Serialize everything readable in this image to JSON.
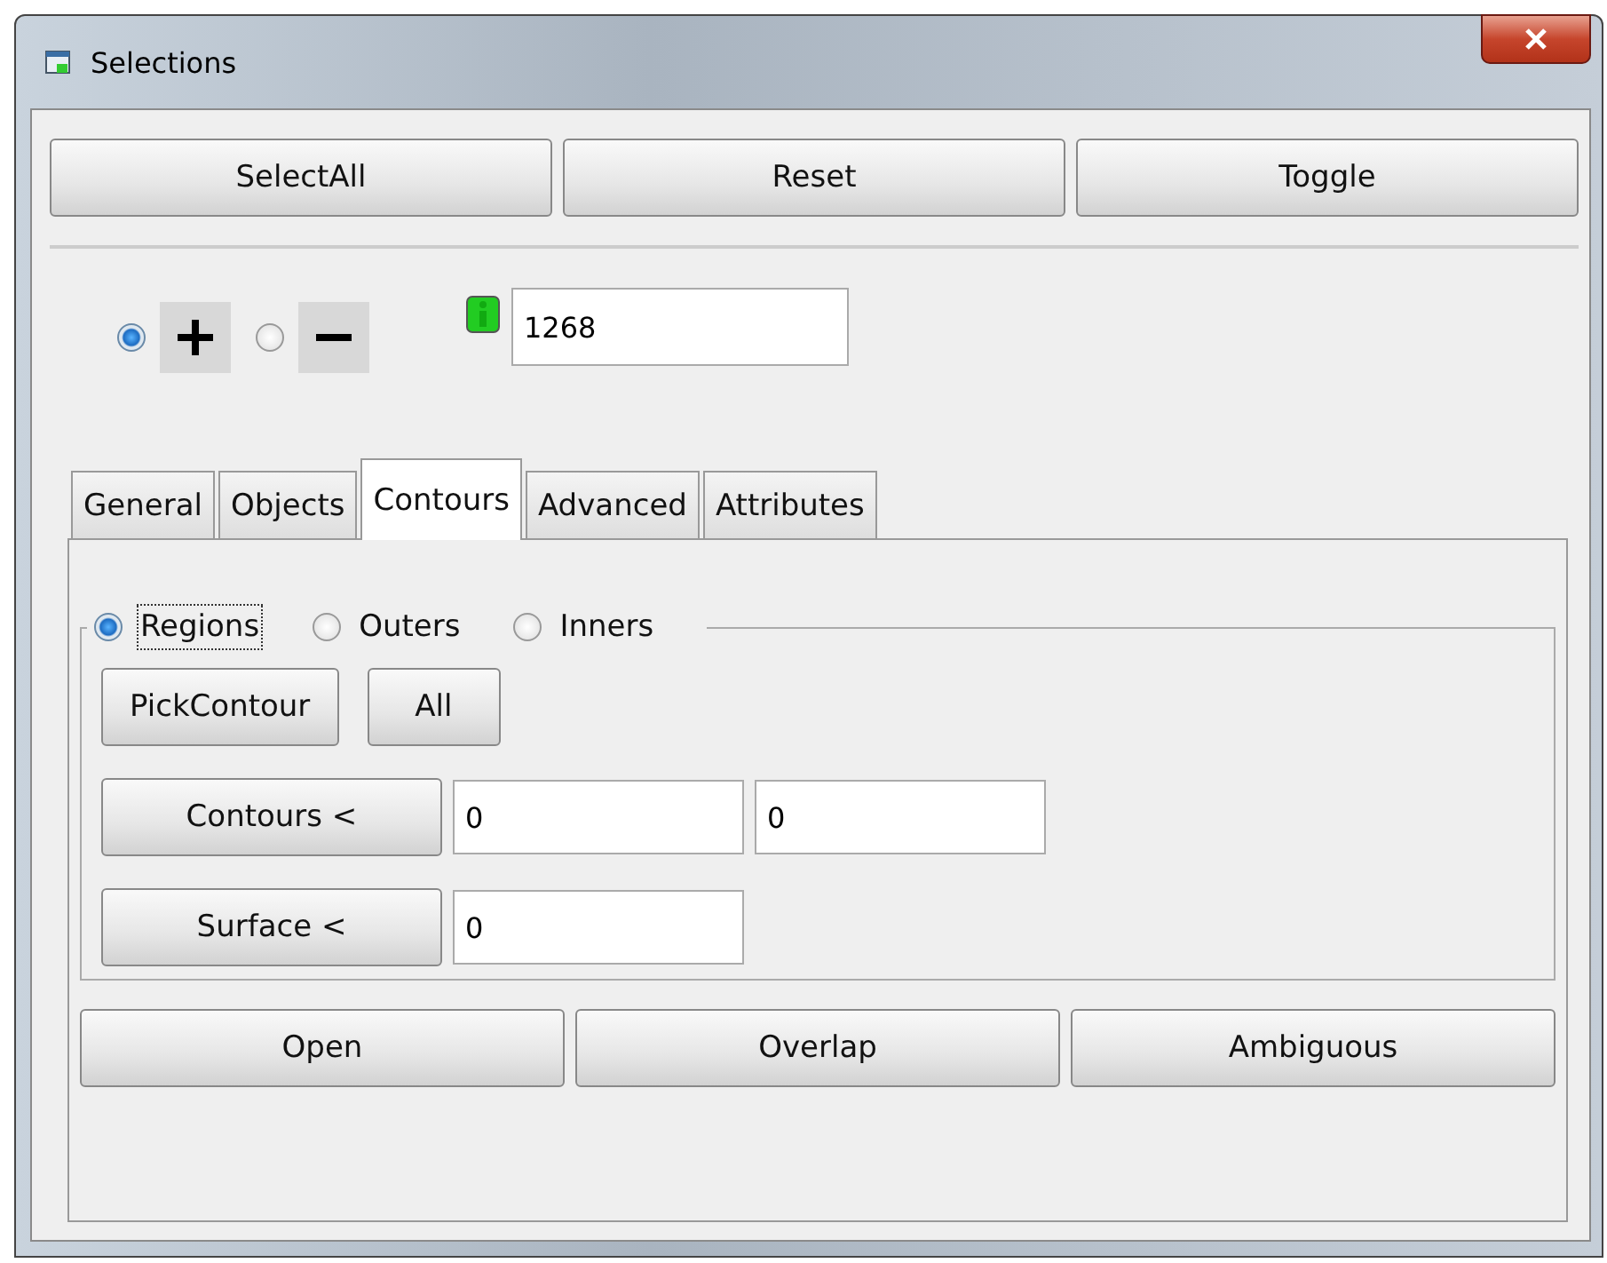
{
  "window": {
    "title": "Selections"
  },
  "top_buttons": [
    "SelectAll",
    "Reset",
    "Toggle"
  ],
  "mode_options": [
    {
      "kind": "add",
      "selected": true
    },
    {
      "kind": "remove",
      "selected": false
    }
  ],
  "count_field": {
    "value": "1268"
  },
  "tabs": [
    {
      "label": "General",
      "selected": false
    },
    {
      "label": "Objects",
      "selected": false
    },
    {
      "label": "Contours",
      "selected": true
    },
    {
      "label": "Advanced",
      "selected": false
    },
    {
      "label": "Attributes",
      "selected": false
    }
  ],
  "contour_types": [
    {
      "label": "Regions",
      "selected": true,
      "focused": true
    },
    {
      "label": "Outers",
      "selected": false,
      "focused": false
    },
    {
      "label": "Inners",
      "selected": false,
      "focused": false
    }
  ],
  "pick_buttons": [
    "PickContour",
    "All"
  ],
  "filters": [
    {
      "label": "Contours  <",
      "values": [
        "0",
        "0"
      ]
    },
    {
      "label": "Surface  <",
      "values": [
        "0"
      ]
    }
  ],
  "bottom_buttons": [
    "Open",
    "Overlap",
    "Ambiguous"
  ]
}
